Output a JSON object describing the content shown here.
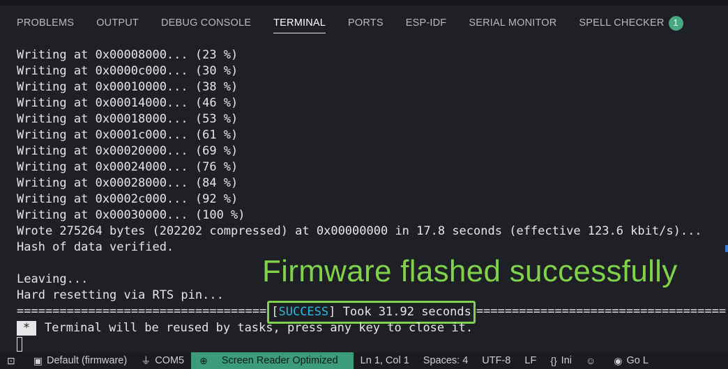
{
  "tabs": [
    {
      "label": "PROBLEMS"
    },
    {
      "label": "OUTPUT"
    },
    {
      "label": "DEBUG CONSOLE"
    },
    {
      "label": "TERMINAL",
      "active": true
    },
    {
      "label": "PORTS"
    },
    {
      "label": "ESP-IDF"
    },
    {
      "label": "SERIAL MONITOR"
    },
    {
      "label": "SPELL CHECKER",
      "badge": "1"
    }
  ],
  "terminal": {
    "lines": [
      "Writing at 0x00008000... (23 %)",
      "Writing at 0x0000c000... (30 %)",
      "Writing at 0x00010000... (38 %)",
      "Writing at 0x00014000... (46 %)",
      "Writing at 0x00018000... (53 %)",
      "Writing at 0x0001c000... (61 %)",
      "Writing at 0x00020000... (69 %)",
      "Writing at 0x00024000... (76 %)",
      "Writing at 0x00028000... (84 %)",
      "Writing at 0x0002c000... (92 %)",
      "Writing at 0x00030000... (100 %)",
      "Wrote 275264 bytes (202202 compressed) at 0x00000000 in 17.8 seconds (effective 123.6 kbit/s)...",
      "Hash of data verified.",
      "",
      "Leaving...",
      "Hard resetting via RTS pin..."
    ],
    "separator_left": "===================================",
    "success_open": "[",
    "success_word": "SUCCESS",
    "success_rest": "] Took 31.92 seconds",
    "separator_right": "===================================",
    "task_marker": "*",
    "task_message": "Terminal will be reused by tasks, press any key to close it."
  },
  "annotation": "Firmware flashed successfully",
  "statusbar": {
    "items": [
      {
        "name": "terminal-icon-item",
        "icon": "terminal-icon",
        "glyph": "⊡",
        "label": ""
      },
      {
        "name": "default-firmware-item",
        "icon": "folder-icon",
        "glyph": "▣",
        "label": "Default (firmware)"
      },
      {
        "name": "com-port-item",
        "icon": "plug-icon",
        "glyph": "⏚",
        "label": "COM5"
      },
      {
        "name": "screen-reader-item",
        "icon": "zoom-icon",
        "glyph": "⊕",
        "label": "Screen Reader Optimized",
        "highlight": true
      },
      {
        "name": "cursor-position-item",
        "icon": "",
        "glyph": "",
        "label": "Ln 1, Col 1"
      },
      {
        "name": "indentation-item",
        "icon": "",
        "glyph": "",
        "label": "Spaces: 4"
      },
      {
        "name": "encoding-item",
        "icon": "",
        "glyph": "",
        "label": "UTF-8"
      },
      {
        "name": "eol-item",
        "icon": "",
        "glyph": "",
        "label": "LF"
      },
      {
        "name": "language-item",
        "icon": "braces-icon",
        "glyph": "{}",
        "label": "Ini"
      },
      {
        "name": "copilot-item",
        "icon": "copilot-icon",
        "glyph": "☺",
        "label": ""
      },
      {
        "name": "go-live-item",
        "icon": "broadcast-icon",
        "glyph": "◉",
        "label": "Go L"
      }
    ]
  }
}
